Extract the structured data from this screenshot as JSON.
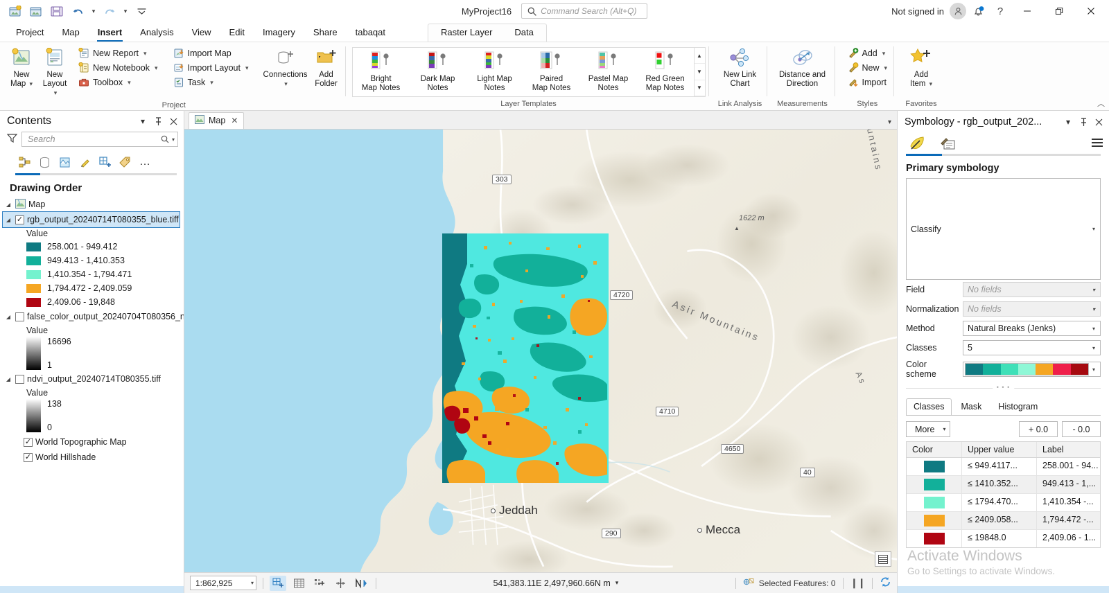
{
  "titlebar": {
    "project_name": "MyProject16",
    "search_placeholder": "Command Search (Alt+Q)",
    "account_status": "Not signed in",
    "qat": [
      {
        "name": "new-project-icon",
        "title": "New Project"
      },
      {
        "name": "open-project-icon",
        "title": "Open Project"
      },
      {
        "name": "save-project-icon",
        "title": "Save Project"
      },
      {
        "name": "undo-icon",
        "title": "Undo"
      },
      {
        "name": "redo-icon",
        "title": "Redo"
      },
      {
        "name": "customize-quick-access-icon",
        "title": "Customize Quick Access Toolbar"
      }
    ],
    "window_controls": {
      "minimize": "—",
      "restore": "❐",
      "close": "✕",
      "help": "?"
    }
  },
  "ribbon": {
    "tabs": [
      {
        "label": "Project",
        "active": false
      },
      {
        "label": "Map",
        "active": false
      },
      {
        "label": "Insert",
        "active": true
      },
      {
        "label": "Analysis",
        "active": false
      },
      {
        "label": "View",
        "active": false
      },
      {
        "label": "Edit",
        "active": false
      },
      {
        "label": "Imagery",
        "active": false
      },
      {
        "label": "Share",
        "active": false
      },
      {
        "label": "tabaqat",
        "active": false
      }
    ],
    "contextual_tabs": [
      {
        "label": "Raster Layer"
      },
      {
        "label": "Data"
      }
    ],
    "groups": [
      {
        "label": "Project",
        "big_buttons": [
          {
            "label": "New\nMap",
            "name": "new-map-button",
            "caret": true
          },
          {
            "label": "New\nLayout",
            "name": "new-layout-button",
            "caret": true
          }
        ],
        "stack1": [
          {
            "label": "New Report",
            "name": "new-report-button",
            "caret": true
          },
          {
            "label": "New Notebook",
            "name": "new-notebook-button",
            "caret": true
          },
          {
            "label": "Toolbox",
            "name": "toolbox-button",
            "caret": true
          }
        ],
        "stack2": [
          {
            "label": "Import Map",
            "name": "import-map-button",
            "caret": false
          },
          {
            "label": "Import Layout",
            "name": "import-layout-button",
            "caret": true
          },
          {
            "label": "Task",
            "name": "task-button",
            "caret": true
          }
        ],
        "big_buttons2": [
          {
            "label": "Connections",
            "name": "connections-button",
            "caret": true
          },
          {
            "label": "Add\nFolder",
            "name": "add-folder-button",
            "caret": false
          }
        ]
      },
      {
        "label": "Layer Templates",
        "gallery": [
          {
            "label": "Bright\nMap Notes",
            "name": "bright-map-notes-template"
          },
          {
            "label": "Dark Map\nNotes",
            "name": "dark-map-notes-template"
          },
          {
            "label": "Light Map\nNotes",
            "name": "light-map-notes-template"
          },
          {
            "label": "Paired\nMap Notes",
            "name": "paired-map-notes-template"
          },
          {
            "label": "Pastel Map\nNotes",
            "name": "pastel-map-notes-template"
          },
          {
            "label": "Red Green\nMap Notes",
            "name": "red-green-map-notes-template"
          }
        ]
      },
      {
        "label": "Link Analysis",
        "big_buttons": [
          {
            "label": "New Link\nChart",
            "name": "new-link-chart-button",
            "caret": false
          }
        ]
      },
      {
        "label": "Measurements",
        "big_buttons": [
          {
            "label": "Distance and\nDirection",
            "name": "distance-and-direction-button",
            "caret": false
          }
        ]
      },
      {
        "label": "Styles",
        "stack1": [
          {
            "label": "Add",
            "name": "styles-add-button",
            "caret": true
          },
          {
            "label": "New",
            "name": "styles-new-button",
            "caret": true
          },
          {
            "label": "Import",
            "name": "styles-import-button",
            "caret": false
          }
        ]
      },
      {
        "label": "Favorites",
        "big_buttons": [
          {
            "label": "Add\nItem",
            "name": "add-item-button",
            "caret": true
          }
        ]
      }
    ]
  },
  "contents": {
    "title": "Contents",
    "search_placeholder": "Search",
    "drawing_order_label": "Drawing Order",
    "toolbar_icons": [
      {
        "name": "list-by-drawing-order-icon"
      },
      {
        "name": "list-by-data-source-icon"
      },
      {
        "name": "list-by-selection-icon"
      },
      {
        "name": "list-by-editing-icon"
      },
      {
        "name": "list-by-snapping-icon"
      },
      {
        "name": "list-by-labeling-icon"
      },
      {
        "name": "more-options-icon"
      }
    ],
    "map_node": "Map",
    "layers": [
      {
        "name": "rgb_output_20240714T080355_blue.tiff",
        "checked": true,
        "selected": true,
        "value_label": "Value",
        "legend_type": "classes",
        "classes": [
          {
            "color": "#0f7a82",
            "label": "258.001 - 949.412"
          },
          {
            "color": "#12b09a",
            "label": "949.413 - 1,410.353"
          },
          {
            "color": "#74f2ce",
            "label": "1,410.354 - 1,794.471"
          },
          {
            "color": "#f5a623",
            "label": "1,794.472 - 2,409.059"
          },
          {
            "color": "#b00512",
            "label": "2,409.06 - 19,848"
          }
        ]
      },
      {
        "name": "false_color_output_20240704T080356_n",
        "checked": false,
        "selected": false,
        "value_label": "Value",
        "legend_type": "ramp",
        "ramp_top": "16696",
        "ramp_bottom": "1"
      },
      {
        "name": "ndvi_output_20240714T080355.tiff",
        "checked": false,
        "selected": false,
        "value_label": "Value",
        "legend_type": "ramp",
        "ramp_top": "138",
        "ramp_bottom": "0"
      }
    ],
    "basemaps": [
      {
        "name": "World Topographic Map",
        "checked": true
      },
      {
        "name": "World Hillshade",
        "checked": true
      }
    ]
  },
  "map": {
    "tab_label": "Map",
    "close_label": "✕",
    "labels": {
      "city_jeddah": "Jeddah",
      "city_mecca": "Mecca",
      "peak_elevation": "1622 m",
      "mountain_range": "Asir Mountains",
      "mountain_range_edge": "Mountains"
    },
    "road_shields": [
      "303",
      "4720",
      "4710",
      "4650",
      "40",
      "290"
    ]
  },
  "statusbar": {
    "scale": "1:862,925",
    "coordinates": "541,383.11E 2,497,960.66N m",
    "selected_features": "Selected Features: 0",
    "tools": [
      {
        "name": "select-by-rectangle-icon",
        "active": true
      },
      {
        "name": "attribute-table-icon",
        "active": false
      },
      {
        "name": "select-features-icon",
        "active": false
      },
      {
        "name": "measure-icon",
        "active": false
      },
      {
        "name": "north-arrow-icon",
        "active": false
      }
    ],
    "pause-drawing": "❘❘",
    "refresh": "↻"
  },
  "symbology": {
    "title": "Symbology - rgb_output_202...",
    "tab_icons": [
      {
        "name": "symbology-primary-icon"
      },
      {
        "name": "symbology-vary-by-attribute-icon"
      }
    ],
    "menu_icon": "hamburger-menu-icon",
    "section_title": "Primary symbology",
    "primary_symbology": "Classify",
    "fields": [
      {
        "label": "Field",
        "value": "No fields",
        "disabled": true
      },
      {
        "label": "Normalization",
        "value": "No fields",
        "disabled": true
      },
      {
        "label": "Method",
        "value": "Natural Breaks (Jenks)",
        "disabled": false
      },
      {
        "label": "Classes",
        "value": "5",
        "disabled": false
      }
    ],
    "color_scheme_label": "Color scheme",
    "color_scheme": [
      "#0f7a82",
      "#12b09a",
      "#3fe0b8",
      "#8ff7d6",
      "#f5a623",
      "#ef1f4a",
      "#a60a10"
    ],
    "tabs": [
      {
        "label": "Classes",
        "active": true
      },
      {
        "label": "Mask",
        "active": false
      },
      {
        "label": "Histogram",
        "active": false
      }
    ],
    "more_label": "More",
    "plus_label": "+ 0.0",
    "minus_label": "- 0.0",
    "table_headers": {
      "color": "Color",
      "upper": "Upper value",
      "label": "Label"
    },
    "table_rows": [
      {
        "color": "#0f7a82",
        "upper": "≤  949.4117...",
        "label": "258.001 - 94..."
      },
      {
        "color": "#12b09a",
        "upper": "≤  1410.352...",
        "label": "949.413 - 1,..."
      },
      {
        "color": "#74f2ce",
        "upper": "≤  1794.470...",
        "label": "1,410.354 -..."
      },
      {
        "color": "#f5a623",
        "upper": "≤  2409.058...",
        "label": "1,794.472 -..."
      },
      {
        "color": "#b00512",
        "upper": "≤  19848.0",
        "label": "2,409.06 - 1..."
      }
    ]
  },
  "watermark": {
    "line1": "Activate Windows",
    "line2": "Go to Settings to activate Windows."
  },
  "colors": {
    "accent": "#0b6ab8",
    "selection": "#cfe6f7",
    "ocean": "#aadcf0",
    "land": "#f2efe6"
  }
}
